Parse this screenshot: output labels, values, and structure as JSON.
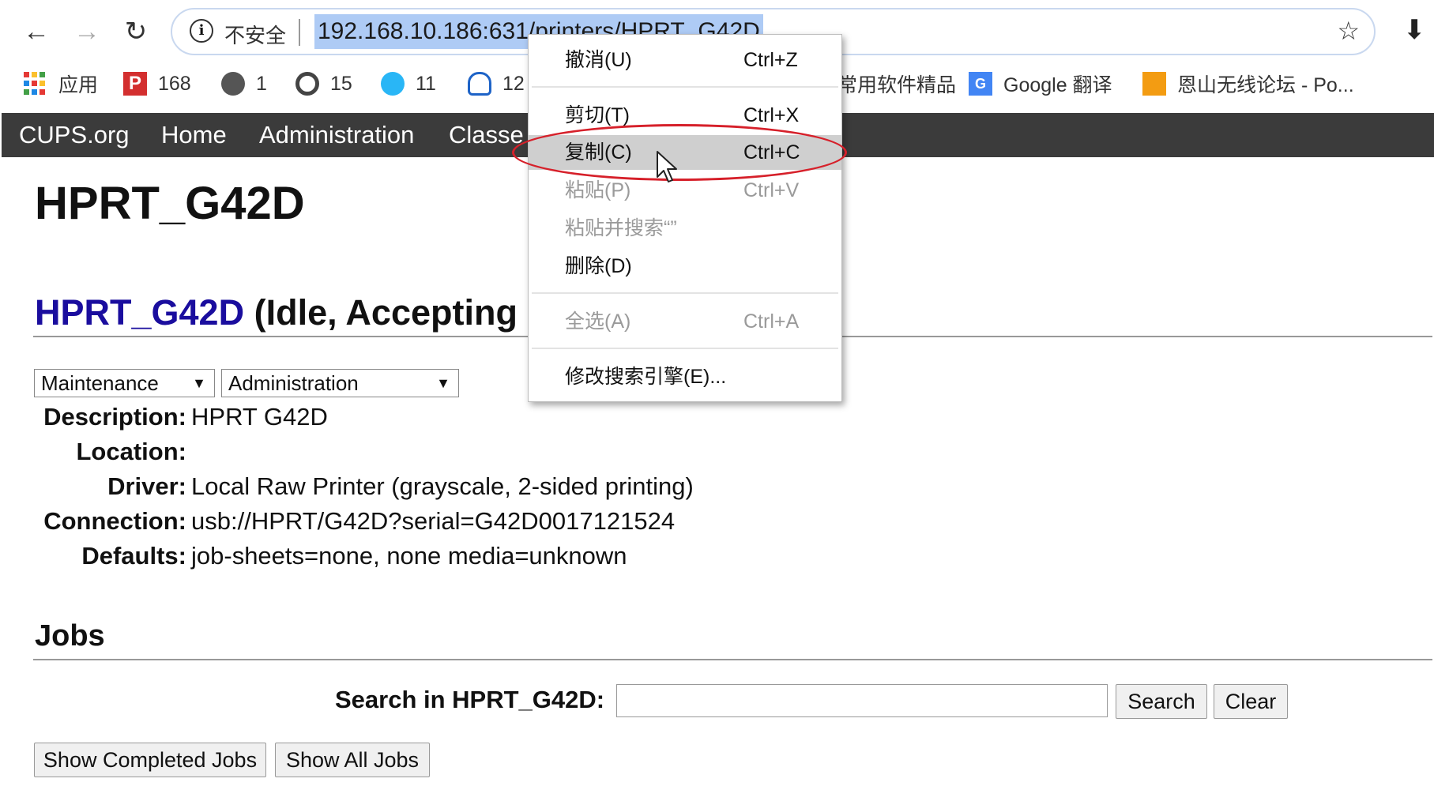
{
  "browser": {
    "insecure_label": "不安全",
    "url": "192.168.10.186:631/printers/HPRT_G42D",
    "bookmarks": [
      {
        "label": "应用",
        "icon": "apps-grid-icon"
      },
      {
        "label": "168",
        "icon": "red-p-icon"
      },
      {
        "label": "1",
        "icon": "globe-icon"
      },
      {
        "label": "15",
        "icon": "record-icon"
      },
      {
        "label": "11",
        "icon": "eye-icon"
      },
      {
        "label": "12",
        "icon": "cloud-icon"
      },
      {
        "label": "常用软件精品",
        "icon": ""
      },
      {
        "label": "Google 翻译",
        "icon": "google-translate-icon"
      },
      {
        "label": "恩山无线论坛 - Po...",
        "icon": "enshan-icon"
      }
    ]
  },
  "cups_nav": [
    "CUPS.org",
    "Home",
    "Administration",
    "Classe"
  ],
  "page": {
    "title": "HPRT_G42D",
    "printer_link": "HPRT_G42D",
    "printer_status": "(Idle, Accepting",
    "maintenance_select": "Maintenance",
    "administration_select": "Administration",
    "info": [
      {
        "label": "Description:",
        "value": "HPRT G42D"
      },
      {
        "label": "Location:",
        "value": ""
      },
      {
        "label": "Driver:",
        "value": "Local Raw Printer (grayscale, 2-sided printing)"
      },
      {
        "label": "Connection:",
        "value": "usb://HPRT/G42D?serial=G42D0017121524"
      },
      {
        "label": "Defaults:",
        "value": "job-sheets=none, none media=unknown"
      }
    ],
    "jobs_heading": "Jobs",
    "search_label": "Search in HPRT_G42D:",
    "search_value": "",
    "search_button": "Search",
    "clear_button": "Clear",
    "show_completed_button": "Show Completed Jobs",
    "show_all_button": "Show All Jobs"
  },
  "context_menu": [
    {
      "label": "撤消(U)",
      "shortcut": "Ctrl+Z",
      "disabled": false
    },
    {
      "label": "剪切(T)",
      "shortcut": "Ctrl+X",
      "disabled": false
    },
    {
      "label": "复制(C)",
      "shortcut": "Ctrl+C",
      "disabled": false,
      "highlighted": true
    },
    {
      "label": "粘贴(P)",
      "shortcut": "Ctrl+V",
      "disabled": true
    },
    {
      "label": "粘贴并搜索“”",
      "shortcut": "",
      "disabled": true
    },
    {
      "label": "删除(D)",
      "shortcut": "",
      "disabled": false
    },
    {
      "label": "全选(A)",
      "shortcut": "Ctrl+A",
      "disabled": true
    },
    {
      "label": "修改搜索引擎(E)...",
      "shortcut": "",
      "disabled": false
    }
  ],
  "colors": {
    "cups_bar": "#3b3b3b",
    "printer_link": "#1a0d9e",
    "url_selection": "#aecbf5",
    "menu_highlight": "#cfcfcf",
    "annotation_ring": "#d6202a"
  }
}
